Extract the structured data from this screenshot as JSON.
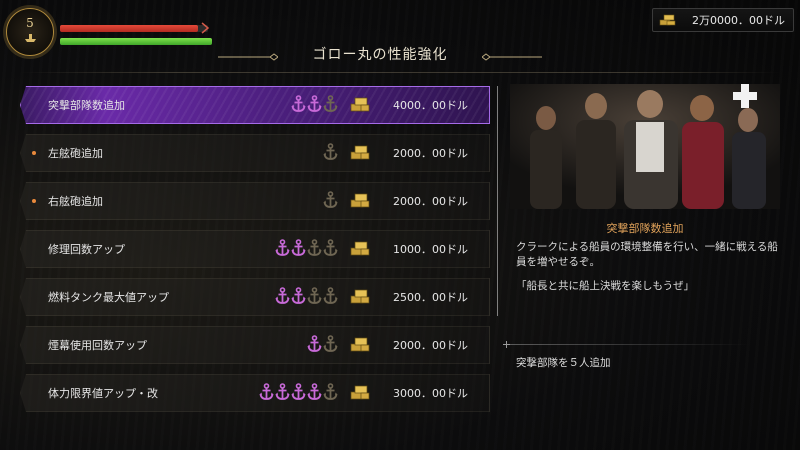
{
  "hud": {
    "level": "5",
    "hp_fraction": 0.93,
    "fuel_fraction": 1.0,
    "money": "2万0000．00ドル"
  },
  "screen_title": "ゴロー丸の性能強化",
  "upgrades": [
    {
      "label": "突撃部隊数追加",
      "price": "4000．00ドル",
      "anchors_filled": 2,
      "anchors_total": 3,
      "selected": true,
      "new": false
    },
    {
      "label": "左舷砲追加",
      "price": "2000．00ドル",
      "anchors_filled": 0,
      "anchors_total": 1,
      "selected": false,
      "new": true
    },
    {
      "label": "右舷砲追加",
      "price": "2000．00ドル",
      "anchors_filled": 0,
      "anchors_total": 1,
      "selected": false,
      "new": true
    },
    {
      "label": "修理回数アップ",
      "price": "1000．00ドル",
      "anchors_filled": 2,
      "anchors_total": 4,
      "selected": false,
      "new": false
    },
    {
      "label": "燃料タンク最大値アップ",
      "price": "2500．00ドル",
      "anchors_filled": 2,
      "anchors_total": 4,
      "selected": false,
      "new": false
    },
    {
      "label": "煙幕使用回数アップ",
      "price": "2000．00ドル",
      "anchors_filled": 1,
      "anchors_total": 2,
      "selected": false,
      "new": false
    },
    {
      "label": "体力限界値アップ・改",
      "price": "3000．00ドル",
      "anchors_filled": 4,
      "anchors_total": 5,
      "selected": false,
      "new": false
    }
  ],
  "detail": {
    "title": "突撃部隊数追加",
    "description": "クラークによる船員の環境整備を行い、一緒に戦える船員を増やせるぞ。",
    "quote": "「船長と共に船上決戦を楽しもうぜ」",
    "effect": "突撃部隊を５人追加"
  },
  "colors": {
    "accent_purple": "#6a2aa8",
    "anchor_filled": "#c86ad8",
    "anchor_empty": "#6f6653",
    "hp": "#e44a3a",
    "fuel": "#7fe24b",
    "detail_title": "#e0a25a"
  },
  "icons": {
    "anchor": "anchor-icon",
    "chest": "gold-chest-icon",
    "money": "gold-stack-icon",
    "plus": "plus-icon",
    "level": "ship-wheel-icon"
  }
}
